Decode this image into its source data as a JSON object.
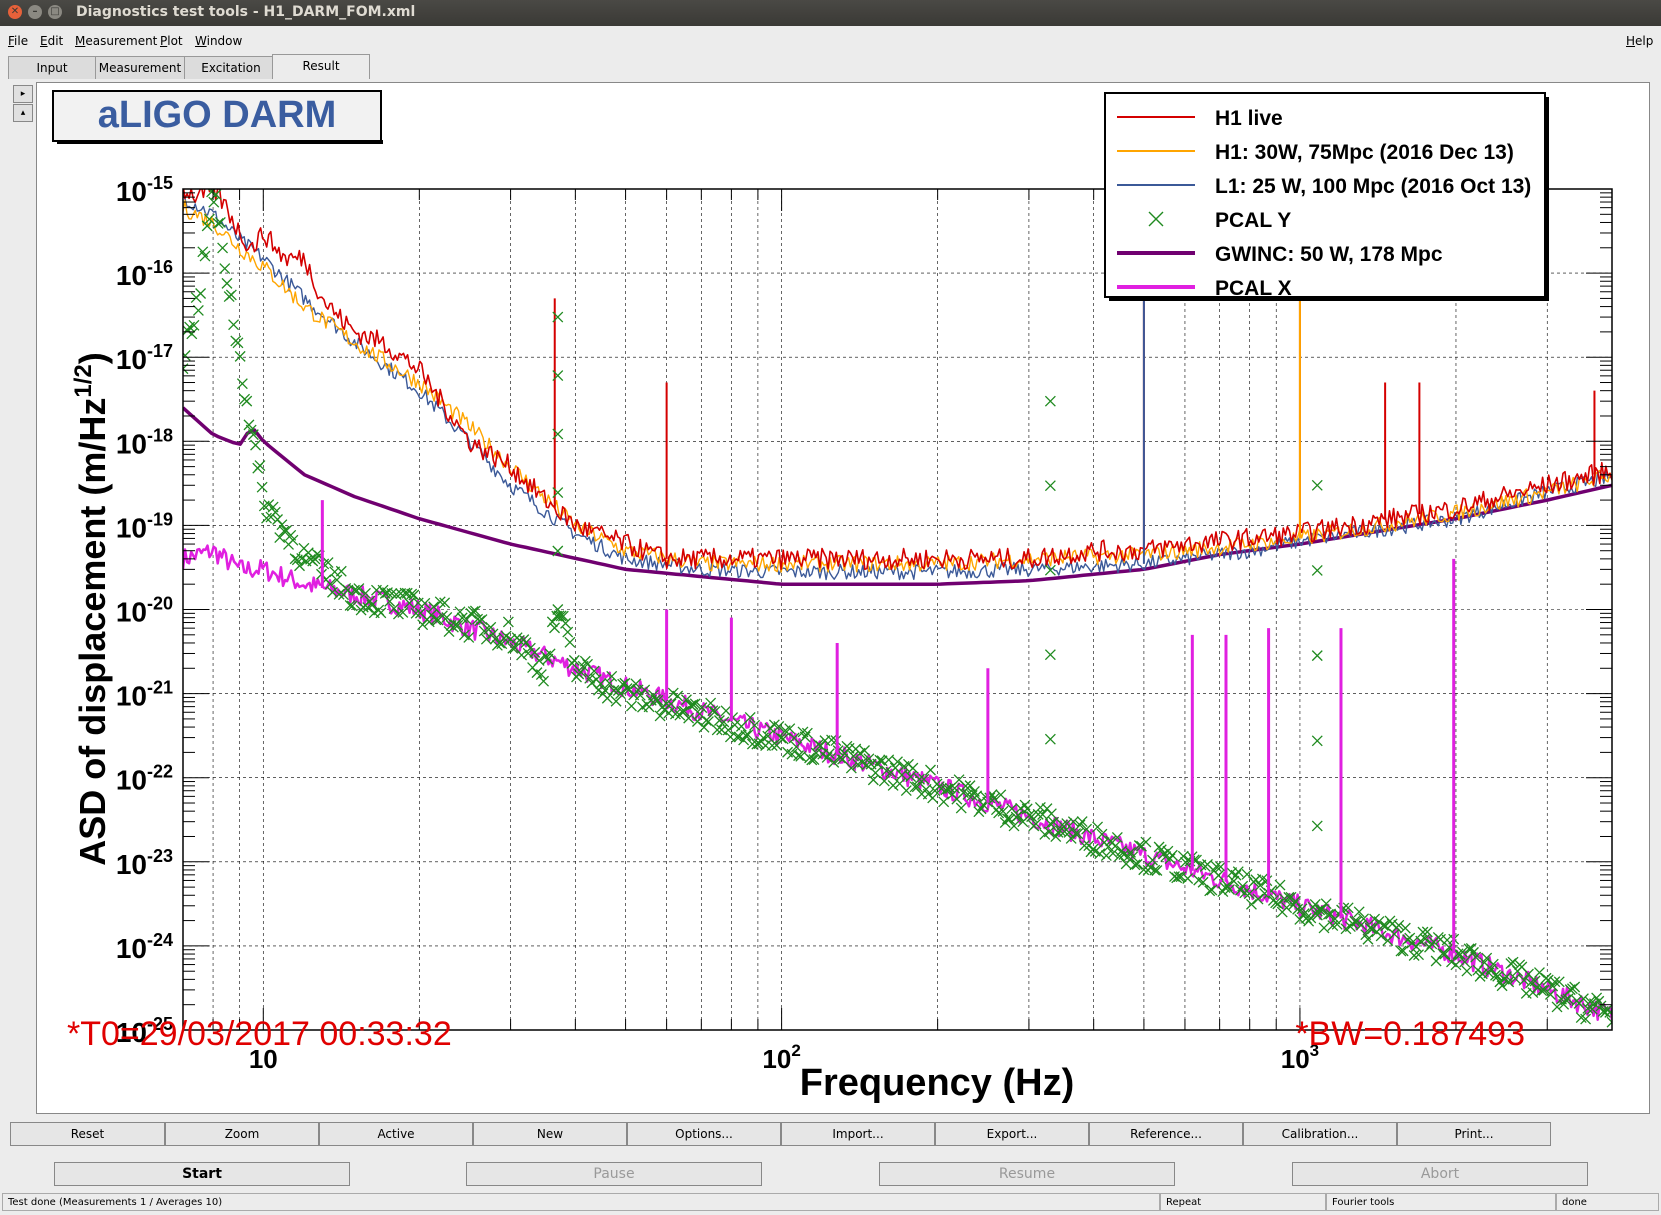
{
  "window": {
    "title": "Diagnostics test tools - H1_DARM_FOM.xml"
  },
  "menu": {
    "items": [
      "File",
      "Edit",
      "Measurement",
      "Plot",
      "Window"
    ],
    "help": "Help"
  },
  "tabs": [
    "Input",
    "Measurement",
    "Excitation",
    "Result"
  ],
  "active_tab": "Result",
  "plot": {
    "box_title": "aLIGO DARM",
    "t0_text": "*T0=29/03/2017 00:33:32",
    "bw_text": "*BW=0.187493",
    "legend": [
      {
        "label": "H1 live",
        "color": "#d40000",
        "style": "line"
      },
      {
        "label": "H1: 30W, 75Mpc (2016 Dec 13)",
        "color": "#ffa500",
        "style": "line"
      },
      {
        "label": "L1: 25 W, 100 Mpc (2016 Oct 13)",
        "color": "#3b5998",
        "style": "line"
      },
      {
        "label": "PCAL Y",
        "color": "#1f8a1f",
        "style": "marker-x"
      },
      {
        "label": "GWINC: 50 W, 178 Mpc",
        "color": "#700070",
        "style": "thick-line"
      },
      {
        "label": "PCAL X",
        "color": "#e020e0",
        "style": "thick-line"
      }
    ]
  },
  "chart_data": {
    "type": "line",
    "title": "aLIGO DARM",
    "xlabel": "Frequency (Hz)",
    "ylabel": "ASD of displacement (m/Hz",
    "ylabel_sup": "1/2",
    "ylabel_end": ")",
    "x_scale": "log",
    "y_scale": "log",
    "xlim": [
      7,
      4000
    ],
    "ylim": [
      1e-25,
      1e-15
    ],
    "x_ticks": [
      {
        "value": 10,
        "base": "10",
        "exp": ""
      },
      {
        "value": 100,
        "base": "10",
        "exp": "2"
      },
      {
        "value": 1000,
        "base": "10",
        "exp": "3"
      }
    ],
    "y_ticks": [
      {
        "value": 1e-15,
        "base": "10",
        "exp": "-15"
      },
      {
        "value": 1e-16,
        "base": "10",
        "exp": "-16"
      },
      {
        "value": 1e-17,
        "base": "10",
        "exp": "-17"
      },
      {
        "value": 1e-18,
        "base": "10",
        "exp": "-18"
      },
      {
        "value": 1e-19,
        "base": "10",
        "exp": "-19"
      },
      {
        "value": 1e-20,
        "base": "10",
        "exp": "-20"
      },
      {
        "value": 1e-21,
        "base": "10",
        "exp": "-21"
      },
      {
        "value": 1e-22,
        "base": "10",
        "exp": "-22"
      },
      {
        "value": 1e-23,
        "base": "10",
        "exp": "-23"
      },
      {
        "value": 1e-24,
        "base": "10",
        "exp": "-24"
      },
      {
        "value": 1e-25,
        "base": "10",
        "exp": "-25"
      }
    ],
    "grid": true,
    "legend_position": "top-right",
    "series": [
      {
        "name": "H1 live",
        "color": "#d40000",
        "x": [
          7,
          7.5,
          8,
          8.5,
          9,
          9.5,
          10,
          11,
          12,
          13,
          14,
          15,
          17,
          20,
          25,
          30,
          35,
          40,
          50,
          60,
          80,
          100,
          150,
          200,
          300,
          400,
          500,
          600,
          800,
          1000,
          1500,
          2000,
          3000,
          4000
        ],
        "y": [
          1e-15,
          8e-16,
          1e-15,
          6e-16,
          3e-16,
          2e-16,
          3e-16,
          1.5e-16,
          1.5e-16,
          5e-17,
          3e-17,
          2e-17,
          1.5e-17,
          7e-18,
          1e-18,
          5e-19,
          2e-19,
          1e-19,
          6e-20,
          4e-20,
          4e-20,
          4e-20,
          4e-20,
          4e-20,
          4e-20,
          5e-20,
          5e-20,
          6e-20,
          7e-20,
          8e-20,
          1.2e-19,
          1.6e-19,
          3e-19,
          4.5e-19
        ]
      },
      {
        "name": "H1: 30W, 75Mpc (2016 Dec 13)",
        "color": "#ffa500",
        "x": [
          7,
          8,
          9,
          10,
          12,
          15,
          20,
          25,
          30,
          40,
          50,
          70,
          100,
          200,
          300,
          500,
          800,
          1000,
          2000,
          3000,
          4000
        ],
        "y": [
          6e-16,
          4e-16,
          2e-16,
          1.2e-16,
          4e-17,
          1.5e-17,
          5e-18,
          1.5e-18,
          5e-19,
          1e-19,
          5e-20,
          3.5e-20,
          3.5e-20,
          3.5e-20,
          4e-20,
          4.5e-20,
          6e-20,
          7e-20,
          1.4e-19,
          2.5e-19,
          4e-19
        ]
      },
      {
        "name": "L1: 25 W, 100 Mpc (2016 Oct 13)",
        "color": "#3b5998",
        "x": [
          7,
          8,
          9,
          10,
          12,
          15,
          20,
          25,
          30,
          40,
          50,
          70,
          100,
          200,
          300,
          500,
          800,
          1000,
          2000,
          3000,
          4000
        ],
        "y": [
          8e-16,
          5e-16,
          2.5e-16,
          1.5e-16,
          5e-17,
          1.5e-17,
          4e-18,
          1e-18,
          3e-19,
          8e-20,
          4e-20,
          3e-20,
          2.8e-20,
          2.8e-20,
          3e-20,
          3.5e-20,
          5e-20,
          6.5e-20,
          1.2e-19,
          2.5e-19,
          3.8e-19
        ]
      },
      {
        "name": "GWINC: 50 W, 178 Mpc",
        "color": "#700070",
        "x": [
          7,
          8,
          9,
          9.5,
          10,
          12,
          15,
          20,
          30,
          50,
          100,
          200,
          300,
          500,
          700,
          1000,
          2000,
          3000,
          4000
        ],
        "y": [
          2.5e-18,
          1.2e-18,
          9e-19,
          1.5e-18,
          1e-18,
          4e-19,
          2.2e-19,
          1.2e-19,
          6e-20,
          3e-20,
          2e-20,
          2e-20,
          2.2e-20,
          3e-20,
          4.5e-20,
          6e-20,
          1.2e-19,
          2e-19,
          3e-19
        ]
      },
      {
        "name": "PCAL X",
        "color": "#e020e0",
        "x": [
          7,
          8,
          9,
          10,
          12,
          15,
          20,
          30,
          40,
          50,
          100,
          200,
          500,
          1000,
          2000,
          3000,
          4000
        ],
        "y": [
          4e-20,
          5e-20,
          3e-20,
          3e-20,
          2e-20,
          1.5e-20,
          1e-20,
          4e-21,
          2e-21,
          1.2e-21,
          3e-22,
          8e-23,
          1.2e-23,
          3e-24,
          8e-25,
          3e-25,
          1.5e-25
        ]
      },
      {
        "name": "PCAL Y",
        "color": "#1f8a1f",
        "x": [
          7,
          7.5,
          8,
          8.5,
          9,
          10,
          12,
          15,
          20,
          30,
          35,
          37,
          40,
          50,
          100,
          200,
          500,
          1000,
          2000,
          3000,
          4000
        ],
        "y": [
          1e-17,
          5e-17,
          1e-15,
          1e-16,
          1e-17,
          2e-19,
          4e-20,
          1.5e-20,
          1e-20,
          5e-21,
          2e-21,
          1e-20,
          2e-21,
          1e-21,
          3e-22,
          8e-23,
          1.2e-23,
          3e-24,
          8e-25,
          3e-25,
          1.5e-25
        ]
      }
    ],
    "spikes": [
      {
        "series": "H1 live",
        "x": 36.5,
        "y": 5e-17
      },
      {
        "series": "H1 live",
        "x": 60,
        "y": 5e-18
      },
      {
        "series": "H1 live",
        "x": 500,
        "y": 5e-16
      },
      {
        "series": "L1: 25 W, 100 Mpc (2016 Oct 13)",
        "x": 500,
        "y": 5e-16
      },
      {
        "series": "H1 live",
        "x": 1000,
        "y": 5e-16
      },
      {
        "series": "H1: 30W, 75Mpc (2016 Dec 13)",
        "x": 1000,
        "y": 5e-16
      },
      {
        "series": "H1 live",
        "x": 1460,
        "y": 5e-18
      },
      {
        "series": "H1 live",
        "x": 1700,
        "y": 5e-18
      },
      {
        "series": "H1 live",
        "x": 3700,
        "y": 4e-18
      },
      {
        "series": "PCAL X",
        "x": 13,
        "y": 2e-19
      },
      {
        "series": "PCAL X",
        "x": 60,
        "y": 1e-20
      },
      {
        "series": "PCAL X",
        "x": 80,
        "y": 8e-21
      },
      {
        "series": "PCAL X",
        "x": 128,
        "y": 4e-21
      },
      {
        "series": "PCAL X",
        "x": 250,
        "y": 2e-21
      },
      {
        "series": "PCAL X",
        "x": 620,
        "y": 5e-21
      },
      {
        "series": "PCAL X",
        "x": 720,
        "y": 5e-21
      },
      {
        "series": "PCAL X",
        "x": 870,
        "y": 6e-21
      },
      {
        "series": "PCAL X",
        "x": 1200,
        "y": 6e-21
      },
      {
        "series": "PCAL X",
        "x": 1980,
        "y": 4e-20
      },
      {
        "series": "PCAL Y",
        "x": 330,
        "y": 3e-18
      },
      {
        "series": "PCAL Y",
        "x": 1080,
        "y": 3e-19
      },
      {
        "series": "PCAL Y",
        "x": 37,
        "y": 3e-17
      }
    ]
  },
  "bottom_buttons": [
    "Reset",
    "Zoom",
    "Active",
    "New",
    "Options...",
    "Import...",
    "Export...",
    "Reference...",
    "Calibration...",
    "Print..."
  ],
  "run_buttons": [
    {
      "label": "Start",
      "enabled": true
    },
    {
      "label": "Pause",
      "enabled": false
    },
    {
      "label": "Resume",
      "enabled": false
    },
    {
      "label": "Abort",
      "enabled": false
    }
  ],
  "status": {
    "message": "Test done (Measurements 1 / Averages 10)",
    "mode": "Repeat",
    "tool": "Fourier tools",
    "state": "done"
  }
}
